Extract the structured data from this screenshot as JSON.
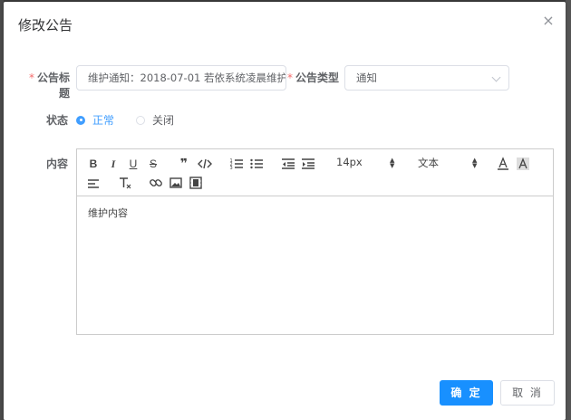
{
  "dialog": {
    "title": "修改公告",
    "close_symbol": "×"
  },
  "form": {
    "title_label": "公告标题",
    "title_value": "维护通知：2018-07-01 若依系统凌晨维护",
    "type_label": "公告类型",
    "type_value": "通知",
    "status_label": "状态",
    "status_options": [
      "正常",
      "关闭"
    ],
    "status_selected": "正常",
    "content_label": "内容",
    "required_mark": "*"
  },
  "editor": {
    "size_picker": "14px",
    "header_picker": "文本",
    "content": "维护内容"
  },
  "footer": {
    "confirm_label": "确 定",
    "cancel_label": "取 消"
  },
  "colors": {
    "primary": "#1890ff",
    "radio_checked": "#409eff",
    "required": "#f56c6c"
  }
}
